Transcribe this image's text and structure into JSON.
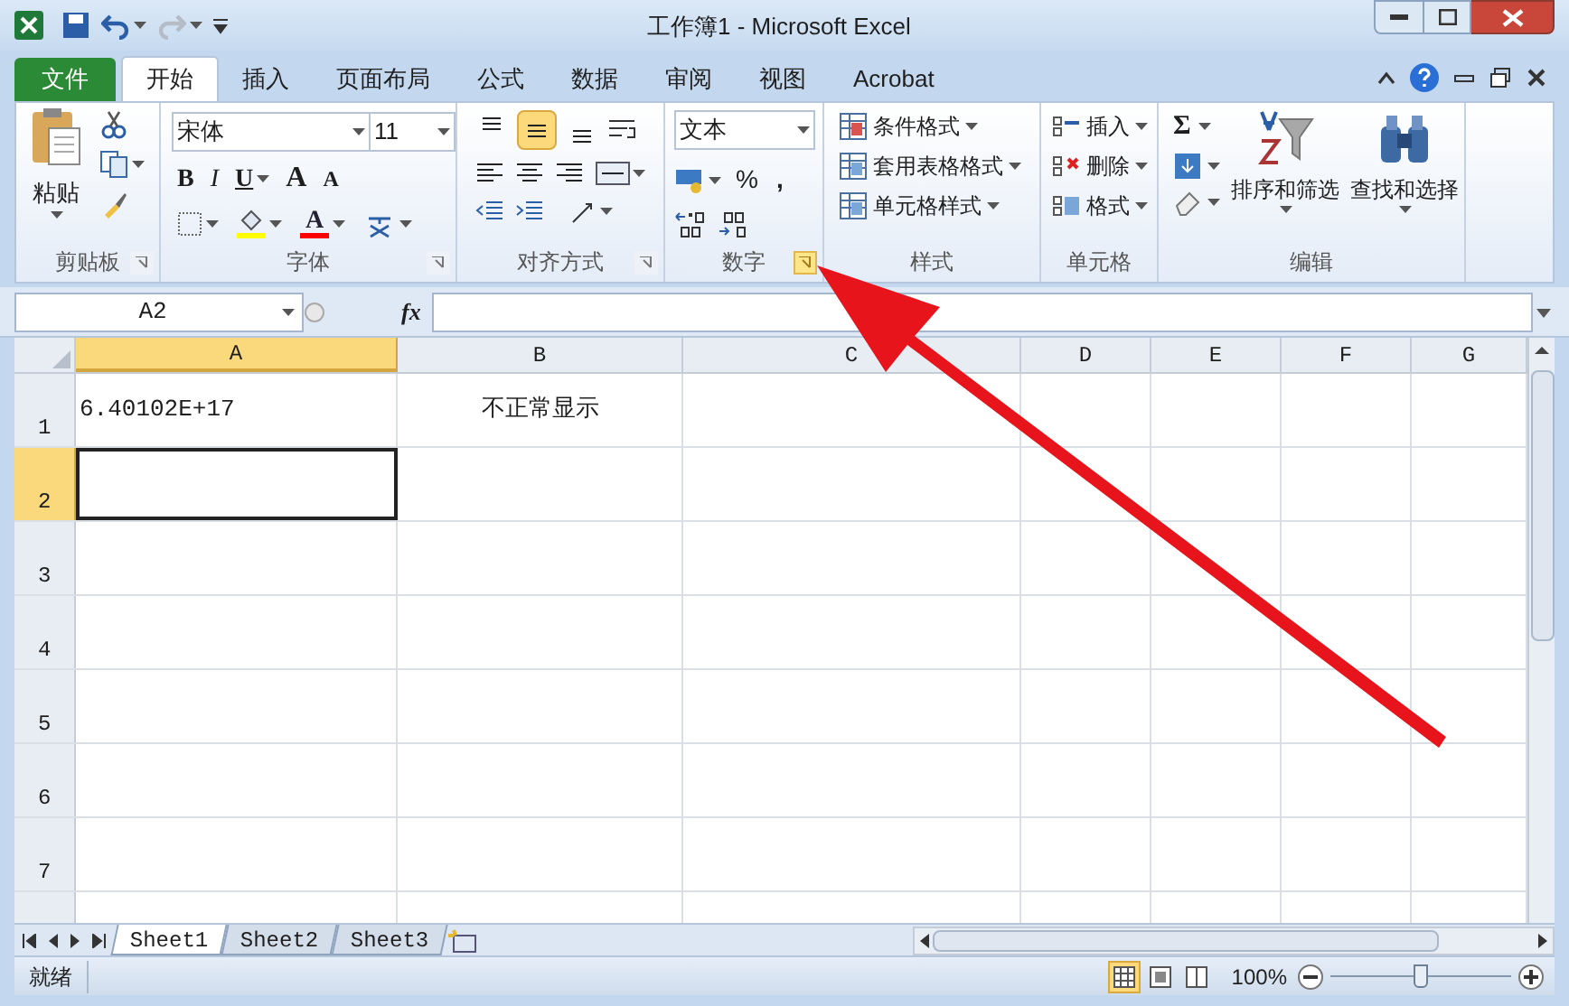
{
  "window": {
    "title": "工作簿1 - Microsoft Excel"
  },
  "quick_access": [
    {
      "kind": "save",
      "disabled": false
    },
    {
      "kind": "undo",
      "disabled": false
    },
    {
      "kind": "redo",
      "disabled": true
    }
  ],
  "file_tab": "文件",
  "tabs": [
    {
      "label": "开始",
      "selected": true
    },
    {
      "label": "插入",
      "selected": false
    },
    {
      "label": "页面布局",
      "selected": false
    },
    {
      "label": "公式",
      "selected": false
    },
    {
      "label": "数据",
      "selected": false
    },
    {
      "label": "审阅",
      "selected": false
    },
    {
      "label": "视图",
      "selected": false
    },
    {
      "label": "Acrobat",
      "selected": false
    }
  ],
  "groups": [
    {
      "kind": "clipboard",
      "label": "剪贴板",
      "launcher": true,
      "launcher_hot": false,
      "paste": "粘贴"
    },
    {
      "kind": "font",
      "label": "字体",
      "launcher": true,
      "launcher_hot": false,
      "font": "宋体",
      "size": "11",
      "bold": "B",
      "italic": "I",
      "underline": "U",
      "grow": "A",
      "shrink": "A",
      "font_color": "A"
    },
    {
      "kind": "alignment",
      "label": "对齐方式",
      "launcher": true,
      "launcher_hot": false,
      "align_buttons": [
        {
          "selected": false
        },
        {
          "selected": true
        },
        {
          "selected": false
        }
      ]
    },
    {
      "kind": "number",
      "label": "数字",
      "launcher": true,
      "launcher_hot": true,
      "format": "文本",
      "percent": "%",
      "comma": ","
    },
    {
      "kind": "styles",
      "label": "样式",
      "launcher": false,
      "items": [
        "条件格式",
        "套用表格格式",
        "单元格样式"
      ]
    },
    {
      "kind": "cells",
      "label": "单元格",
      "launcher": false,
      "items": [
        "插入",
        "删除",
        "格式"
      ]
    },
    {
      "kind": "editing",
      "label": "编辑",
      "launcher": false,
      "sum": "Σ",
      "sort": "排序和筛选",
      "find": "查找和选择"
    }
  ],
  "formula_bar": {
    "name_box": "A2",
    "fx": "fx"
  },
  "columns": [
    {
      "label": "A",
      "selected": true
    },
    {
      "label": "B",
      "selected": false
    },
    {
      "label": "C",
      "selected": false
    },
    {
      "label": "D",
      "selected": false
    },
    {
      "label": "E",
      "selected": false
    },
    {
      "label": "F",
      "selected": false
    },
    {
      "label": "G",
      "selected": false
    }
  ],
  "rows": [
    {
      "label": "1",
      "selected": false,
      "cells": [
        {
          "text": "6.40102E+17",
          "centered": false
        },
        {
          "text": "不正常显示",
          "centered": true
        }
      ]
    },
    {
      "label": "2",
      "selected": true
    },
    {
      "label": "3",
      "selected": false
    },
    {
      "label": "4",
      "selected": false
    },
    {
      "label": "5",
      "selected": false
    },
    {
      "label": "6",
      "selected": false
    },
    {
      "label": "7",
      "selected": false
    }
  ],
  "sheet_tabs": [
    {
      "label": "Sheet1",
      "selected": true
    },
    {
      "label": "Sheet2",
      "selected": false
    },
    {
      "label": "Sheet3",
      "selected": false
    }
  ],
  "status_bar": {
    "text": "就绪",
    "views": [
      {
        "selected": true
      },
      {
        "selected": false
      },
      {
        "selected": false
      }
    ],
    "zoom": "100%",
    "zoom_slider": {
      "level": 0.5
    }
  }
}
